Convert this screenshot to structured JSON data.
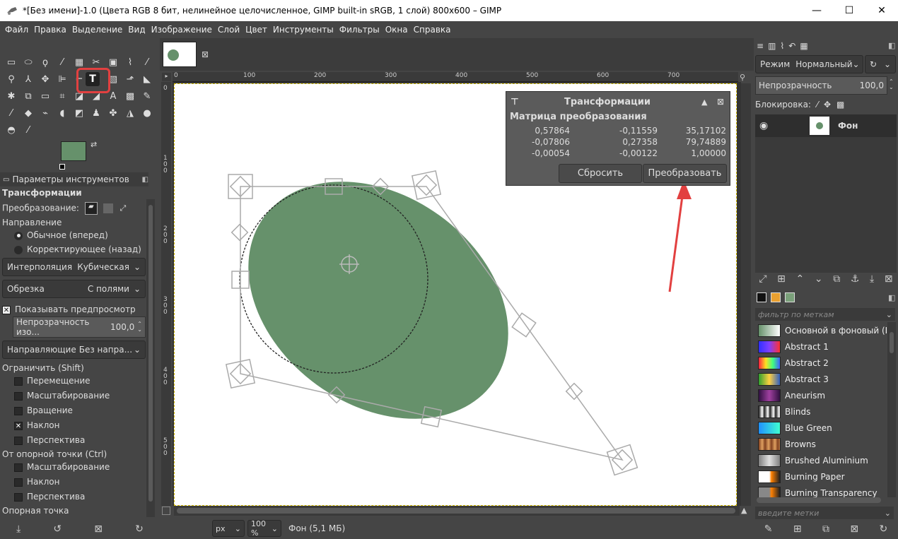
{
  "window": {
    "title": "*[Без имени]-1.0 (Цвета RGB 8 бит, нелинейное целочисленное, GIMP built-in sRGB, 1 слой) 800x600 – GIMP",
    "minimize": "—",
    "maximize": "☐",
    "close": "✕"
  },
  "menu": [
    "Файл",
    "Правка",
    "Выделение",
    "Вид",
    "Изображение",
    "Слой",
    "Цвет",
    "Инструменты",
    "Фильтры",
    "Окна",
    "Справка"
  ],
  "tool_options": {
    "tab_label": "Параметры инструментов",
    "heading": "Трансформации",
    "transform_label": "Преобразование:",
    "direction_label": "Направление",
    "direction_forward": "Обычное (вперед)",
    "direction_backward": "Корректирующее (назад)",
    "interpolation_label": "Интерполяция",
    "interpolation_value": "Кубическая",
    "clipping_label": "Обрезка",
    "clipping_value": "С полями",
    "show_preview": "Показывать предпросмотр",
    "image_opacity_label": "Непрозрачность изо...",
    "image_opacity_value": "100,0",
    "guides_label": "Направляющие",
    "guides_value": "Без напра...",
    "constrain_label": "Ограничить (Shift)",
    "constrain_items": [
      {
        "label": "Перемещение",
        "checked": false
      },
      {
        "label": "Масштабирование",
        "checked": false
      },
      {
        "label": "Вращение",
        "checked": false
      },
      {
        "label": "Наклон",
        "checked": true
      },
      {
        "label": "Перспектива",
        "checked": false
      }
    ],
    "from_pivot_label": "От опорной точки  (Ctrl)",
    "from_pivot_items": [
      {
        "label": "Масштабирование",
        "checked": false
      },
      {
        "label": "Наклон",
        "checked": false
      },
      {
        "label": "Перспектива",
        "checked": false
      }
    ],
    "pivot_label": "Опорная точка"
  },
  "ruler": {
    "top": [
      "0",
      "100",
      "200",
      "300",
      "400",
      "500",
      "600",
      "700"
    ],
    "left": [
      "0",
      "1\n0\n0",
      "2\n0\n0",
      "3\n0\n0",
      "4\n0\n0",
      "5\n0\n0"
    ]
  },
  "transform_dialog": {
    "title": "Трансформации",
    "subtitle": "Матрица преобразования",
    "matrix": [
      [
        "0,57864",
        "-0,11559",
        "35,17102"
      ],
      [
        "-0,07806",
        "0,27358",
        "79,74889"
      ],
      [
        "-0,00054",
        "-0,00122",
        "1,00000"
      ]
    ],
    "reset": "Сбросить",
    "apply": "Преобразовать"
  },
  "status": {
    "unit": "px",
    "zoom": "100 %",
    "layer_info": "Фон (5,1 МБ)"
  },
  "layers": {
    "mode_label": "Режим",
    "mode_value": "Нормальный",
    "opacity_label": "Непрозрачность",
    "opacity_value": "100,0",
    "lock_label": "Блокировка:",
    "layer_name": "Фон"
  },
  "gradients": {
    "filter_placeholder": "фильтр по меткам",
    "tag_placeholder": "введите метки",
    "items": [
      {
        "name": "Основной в фоновый (R",
        "colors": [
          "#66916b",
          "#ffffff"
        ]
      },
      {
        "name": "Abstract 1",
        "colors": [
          "#3030ff",
          "#ff3030"
        ]
      },
      {
        "name": "Abstract 2",
        "colors": [
          "#ff2040",
          "#40ff80"
        ]
      },
      {
        "name": "Abstract 3",
        "colors": [
          "#30a030",
          "#ffd040"
        ]
      },
      {
        "name": "Aneurism",
        "colors": [
          "#301040",
          "#a040a0"
        ]
      },
      {
        "name": "Blinds",
        "colors": [
          "#202020",
          "#ffffff"
        ]
      },
      {
        "name": "Blue Green",
        "colors": [
          "#2090ff",
          "#40ffd0"
        ]
      },
      {
        "name": "Browns",
        "colors": [
          "#804020",
          "#e0a060"
        ]
      },
      {
        "name": "Brushed Aluminium",
        "colors": [
          "#808080",
          "#e0e0e0"
        ]
      },
      {
        "name": "Burning Paper",
        "colors": [
          "#ffffff",
          "#ff8000"
        ]
      },
      {
        "name": "Burning Transparency",
        "colors": [
          "#888888",
          "#ff8000"
        ]
      }
    ]
  },
  "colors": {
    "shape": "#66916b",
    "highlight": "#e24040"
  }
}
